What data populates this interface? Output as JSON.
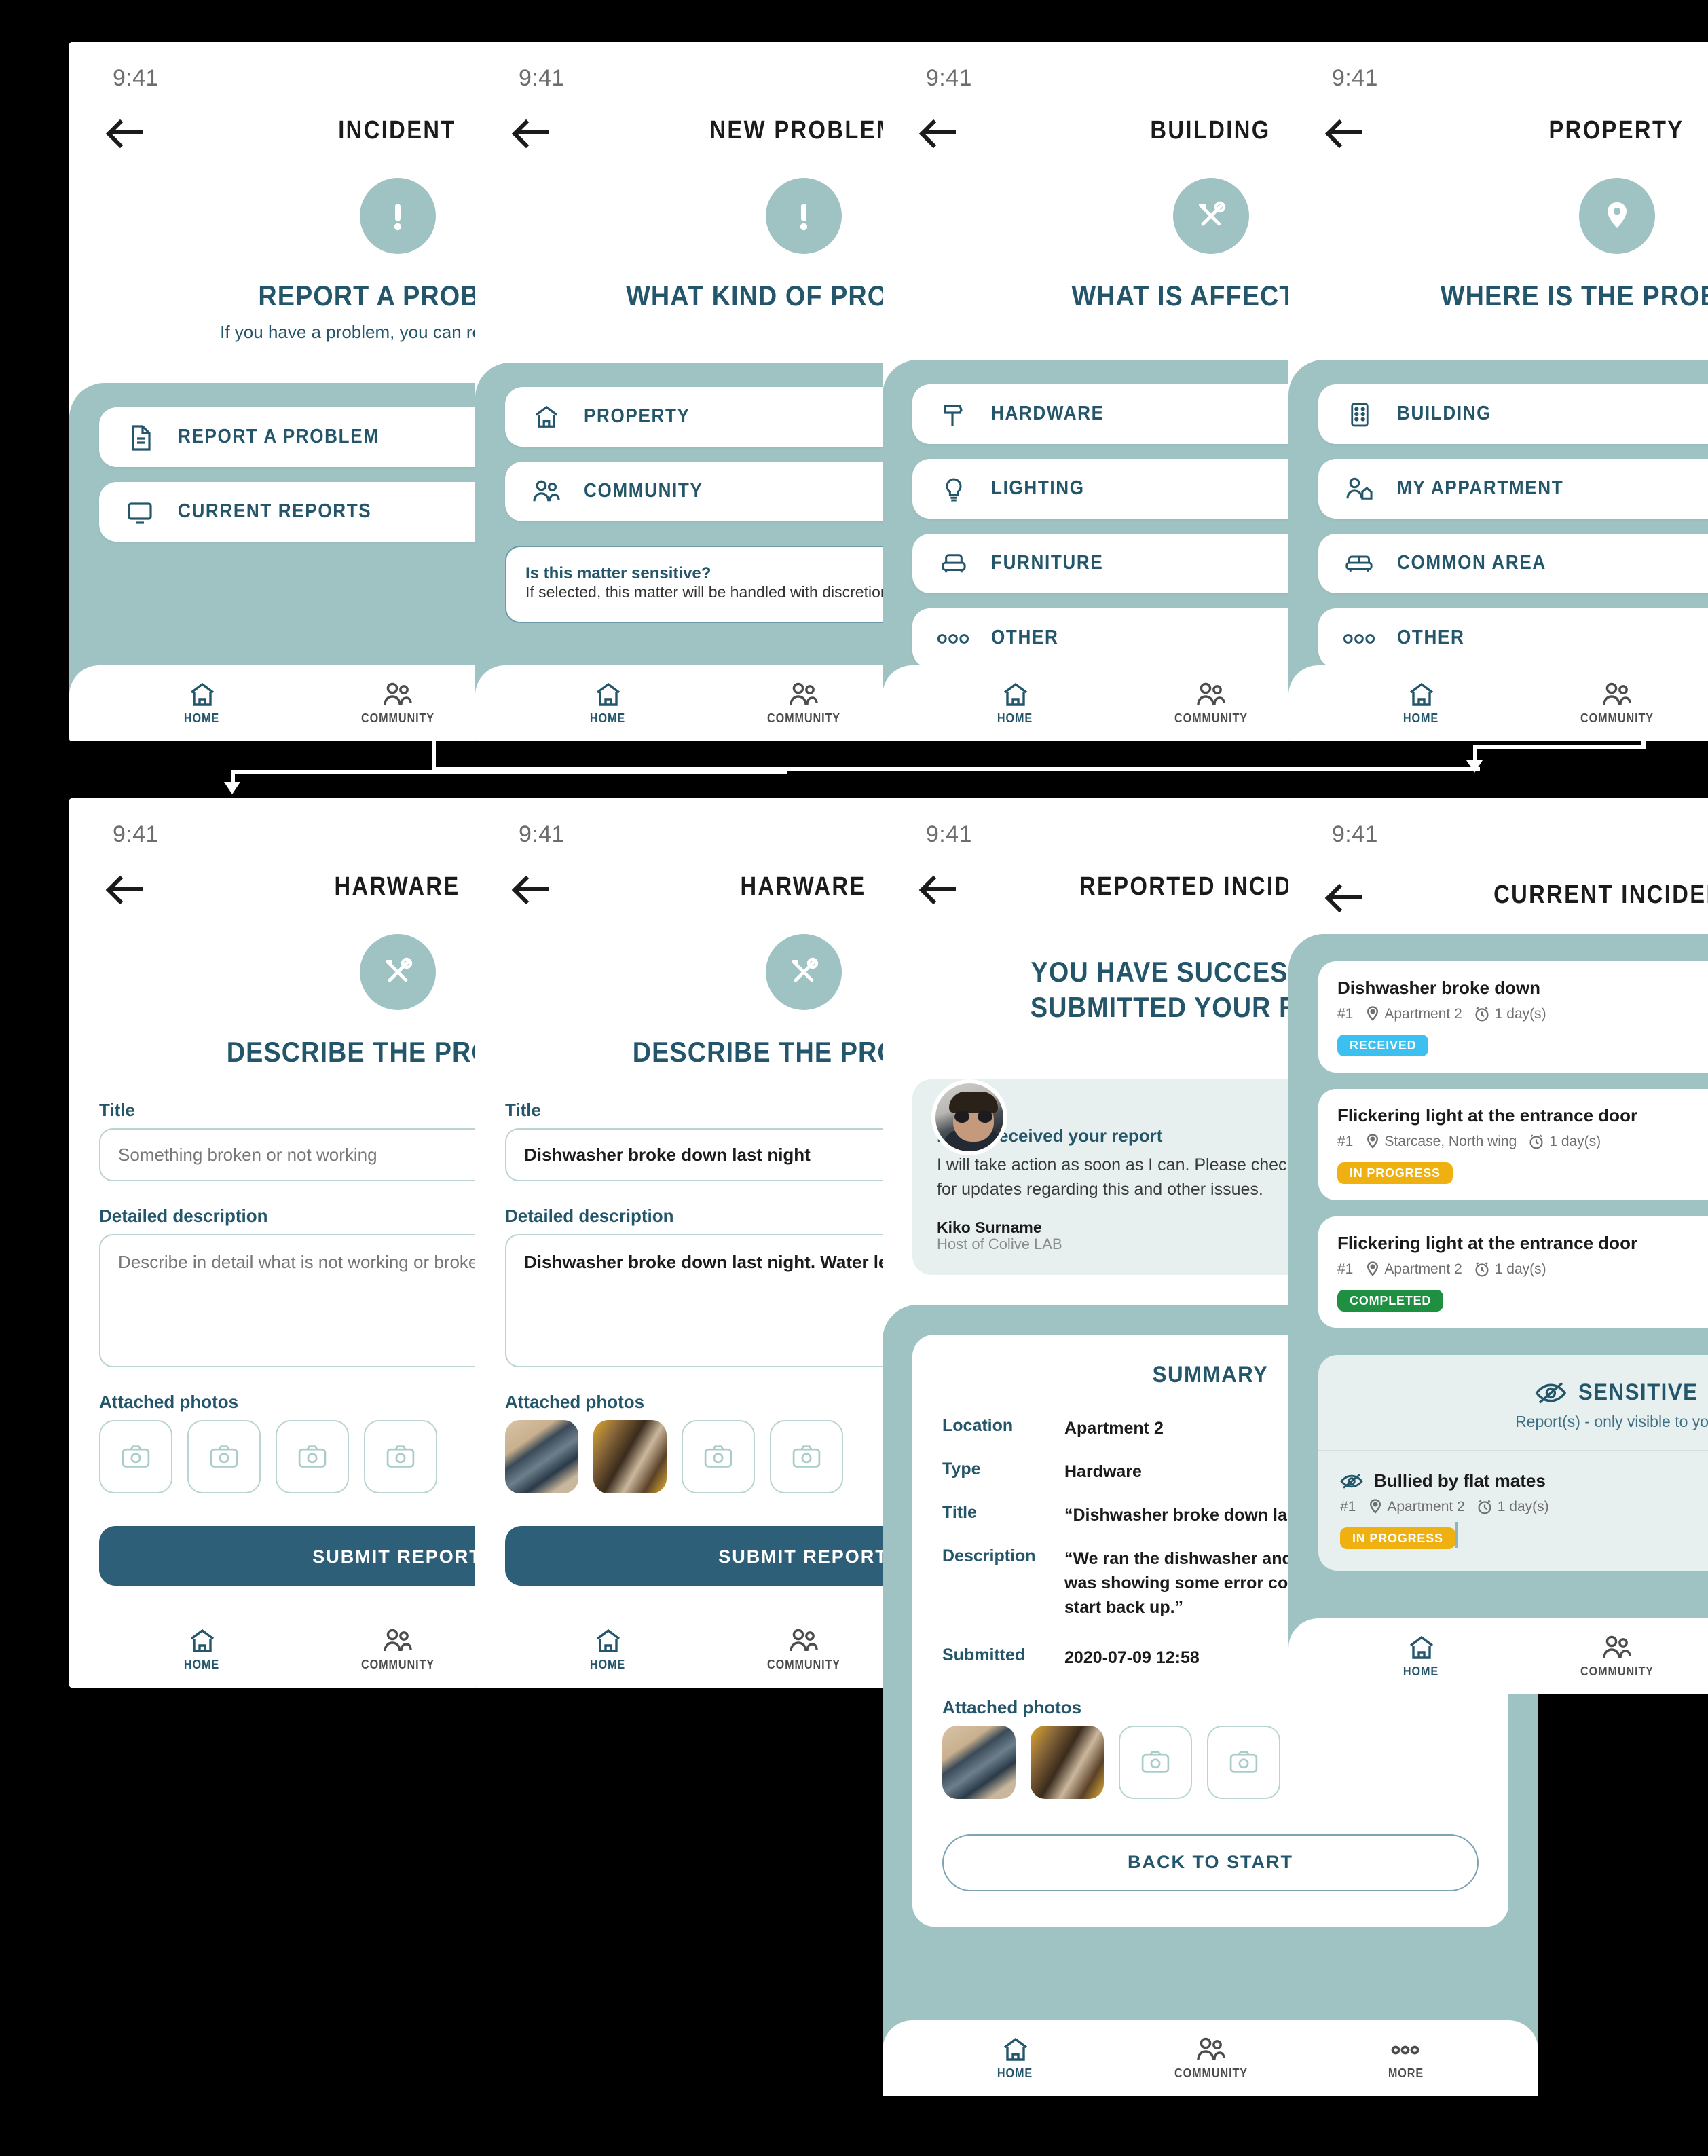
{
  "common": {
    "status_time": "9:41",
    "tabs": [
      {
        "label": "HOME",
        "icon": "home-icon"
      },
      {
        "label": "COMMUNITY",
        "icon": "community-icon"
      },
      {
        "label": "MORE",
        "icon": "more-icon"
      }
    ],
    "colors": {
      "teal": "#9ec3c2",
      "deep_blue": "#24566b",
      "received": "#3cc0ef",
      "in_progress": "#eeb111",
      "completed": "#1f8f42",
      "submit_button": "#2e5f78"
    }
  },
  "screens": {
    "incident": {
      "nav_title": "INCIDENT",
      "hero_icon": "exclamation-icon",
      "hero_title": "REPORT A PROBLEM",
      "hero_sub": "If you have a problem, you can report it to us.",
      "items": [
        {
          "label": "REPORT A PROBLEM",
          "icon": "document-icon"
        },
        {
          "label": "CURRENT REPORTS",
          "icon": "monitor-icon"
        }
      ],
      "dots": {
        "count": 6,
        "active": 0
      }
    },
    "new_problem": {
      "nav_title": "NEW PROBLEM",
      "hero_icon": "exclamation-icon",
      "hero_title": "WHAT KIND OF PROBLEM?",
      "items": [
        {
          "label": "PROPERTY",
          "icon": "home-outline-icon"
        },
        {
          "label": "COMMUNITY",
          "icon": "community-icon"
        }
      ],
      "sensitive": {
        "question": "Is this matter sensitive?",
        "description": "If selected, this matter will be handled with discretion.",
        "toggle_on": true
      },
      "dots": {
        "count": 6,
        "active": 1
      }
    },
    "building": {
      "nav_title": "BUILDING",
      "hero_icon": "tools-icon",
      "hero_title": "WHAT IS AFFECTED?",
      "items": [
        {
          "label": "HARDWARE",
          "icon": "hammer-icon"
        },
        {
          "label": "LIGHTING",
          "icon": "bulb-icon"
        },
        {
          "label": "FURNITURE",
          "icon": "armchair-icon"
        },
        {
          "label": "OTHER",
          "icon": "ellipsis-icon"
        }
      ],
      "dots": {
        "count": 6,
        "active": 3
      }
    },
    "property": {
      "nav_title": "PROPERTY",
      "hero_icon": "pin-icon",
      "hero_title": "WHERE IS THE PROBLEM?",
      "items": [
        {
          "label": "BUILDING",
          "icon": "building-icon"
        },
        {
          "label": "MY APPARTMENT",
          "icon": "person-home-icon"
        },
        {
          "label": "COMMON AREA",
          "icon": "sofa-icon"
        },
        {
          "label": "OTHER",
          "icon": "ellipsis-icon"
        }
      ],
      "dots": {
        "count": 6,
        "active": 2
      }
    },
    "hardware_empty": {
      "nav_title": "HARWARE",
      "hero_icon": "tools-icon",
      "hero_title": "DESCRIBE THE PROBLEM",
      "title_label": "Title",
      "title_placeholder": "Something broken or not working",
      "title_value": "",
      "desc_label": "Detailed description",
      "desc_placeholder": "Describe in detail what is not working or broken",
      "desc_value": "",
      "photos_label": "Attached photos",
      "photo_slots": 4,
      "photos_filled": 0,
      "submit_label": "SUBMIT REPORT",
      "dots": {
        "count": 6,
        "active": 4
      }
    },
    "hardware_filled": {
      "nav_title": "HARWARE",
      "hero_icon": "tools-icon",
      "hero_title": "DESCRIBE THE PROBLEM",
      "title_label": "Title",
      "title_value": "Dishwasher broke down last night",
      "desc_label": "Detailed description",
      "desc_value": "Dishwasher broke down last night. Water leaking from door.",
      "photos_label": "Attached photos",
      "photo_slots": 4,
      "photos_filled": 2,
      "submit_label": "SUBMIT REPORT",
      "dots": {
        "count": 6,
        "active": 4
      }
    },
    "reported_incident": {
      "nav_title": "REPORTED INCIDENT",
      "hero_title": "YOU HAVE SUCCESSFULLY SUBMITTED YOUR REPORT",
      "host": {
        "message_title": "I have received your report",
        "message_body": "I will take action as soon as I can. Please check the incident report list for updates regarding this and other issues.",
        "name": "Kiko Surname",
        "role": "Host of Colive LAB"
      },
      "summary": {
        "title": "SUMMARY",
        "rows": [
          {
            "key": "Location",
            "value": "Apartment 2"
          },
          {
            "key": "Type",
            "value": "Hardware"
          },
          {
            "key": "Title",
            "value": "“Dishwasher broke down last night”"
          },
          {
            "key": "Description",
            "value": "“We ran the dishwasher and when we woke up it was showing some error code and now it won’t start back up.”"
          },
          {
            "key": "Submitted",
            "value": "2020-07-09 12:58"
          }
        ],
        "photos_label": "Attached photos",
        "photo_slots": 4,
        "photos_filled": 2,
        "back_label": "BACK TO START"
      }
    },
    "current_incident": {
      "nav_title": "CURRENT INCIDENT",
      "reports": [
        {
          "title": "Dishwasher broke down",
          "number": "#1",
          "location": "Apartment 2",
          "age": "1 day(s)",
          "status": "RECEIVED",
          "status_color": "#3cc0ef"
        },
        {
          "title": "Flickering light at the entrance door",
          "number": "#1",
          "location": "Starcase, North wing",
          "age": "1 day(s)",
          "status": "IN PROGRESS",
          "status_color": "#eeb111"
        },
        {
          "title": "Flickering light at the entrance door",
          "number": "#1",
          "location": "Apartment 2",
          "age": "1 day(s)",
          "status": "COMPLETED",
          "status_color": "#1f8f42"
        }
      ],
      "sensitive_section": {
        "heading": "SENSITIVE",
        "subheading": "Report(s) - only visible to you",
        "items": [
          {
            "title": "Bullied by flat mates",
            "number": "#1",
            "location": "Apartment 2",
            "age": "1 day(s)",
            "status": "IN PROGRESS",
            "status_color": "#eeb111"
          }
        ]
      }
    }
  }
}
